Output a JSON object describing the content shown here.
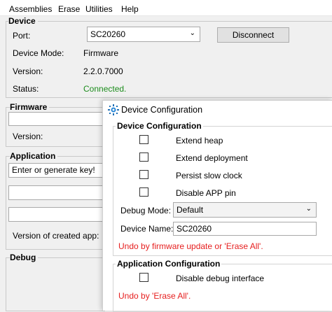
{
  "menu": {
    "items": [
      "Assemblies",
      "Erase",
      "Utilities",
      "Help"
    ]
  },
  "device": {
    "title": "Device",
    "port_label": "Port:",
    "port_value": "SC20260",
    "disconnect_label": "Disconnect",
    "mode_label": "Device Mode:",
    "mode_value": "Firmware",
    "version_label": "Version:",
    "version_value": "2.2.0.7000",
    "status_label": "Status:",
    "status_value": "Connected."
  },
  "firmware": {
    "title": "Firmware",
    "version_label": "Version:"
  },
  "application": {
    "title": "Application",
    "key_placeholder": "Enter or generate key!",
    "created_label": "Version of created app:"
  },
  "debug": {
    "title": "Debug"
  },
  "dialog": {
    "title": "Device Configuration",
    "device_group": {
      "title": "Device Configuration",
      "options": [
        {
          "label": "Extend heap",
          "checked": false
        },
        {
          "label": "Extend deployment",
          "checked": false
        },
        {
          "label": "Persist slow clock",
          "checked": false
        },
        {
          "label": "Disable APP pin",
          "checked": false
        }
      ],
      "debug_mode_label": "Debug Mode:",
      "debug_mode_value": "Default",
      "device_name_label": "Device Name:",
      "device_name_value": "SC20260",
      "undo_note": "Undo by firmware update or 'Erase All'."
    },
    "app_group": {
      "title": "Application Configuration",
      "options": [
        {
          "label": "Disable debug interface",
          "checked": false
        }
      ],
      "undo_note": "Undo by 'Erase All'."
    }
  },
  "colors": {
    "status_ok": "#1c8c1c",
    "warning": "#e61e1e"
  }
}
